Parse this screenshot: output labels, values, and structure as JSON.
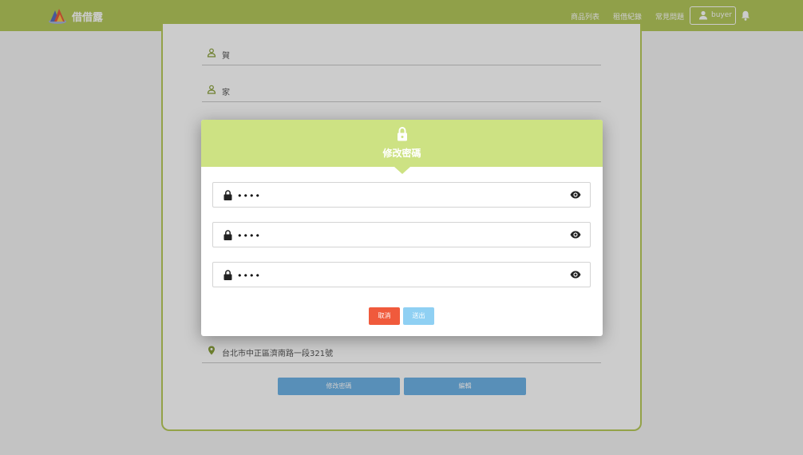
{
  "header": {
    "brand": "借借露",
    "nav": [
      "商品列表",
      "租借紀錄",
      "常見問題"
    ],
    "user": "buyer"
  },
  "profile": {
    "fields": [
      {
        "icon": "user-outline-icon",
        "value": "賀"
      },
      {
        "icon": "user-outline-icon",
        "value": "家"
      }
    ],
    "address": "台北市中正區濟南路一段321號",
    "buttons": {
      "change_password": "修改密碼",
      "edit": "編輯"
    }
  },
  "modal": {
    "title": "修改密碼",
    "passwords": [
      "1234",
      "1234",
      "1234"
    ],
    "cancel": "取消",
    "submit": "送出"
  },
  "colors": {
    "header": "#b4c85c",
    "modal_header": "#cde283",
    "cancel": "#f05a3c",
    "submit": "#8fd0f3",
    "page_button": "#6fb3e6"
  }
}
